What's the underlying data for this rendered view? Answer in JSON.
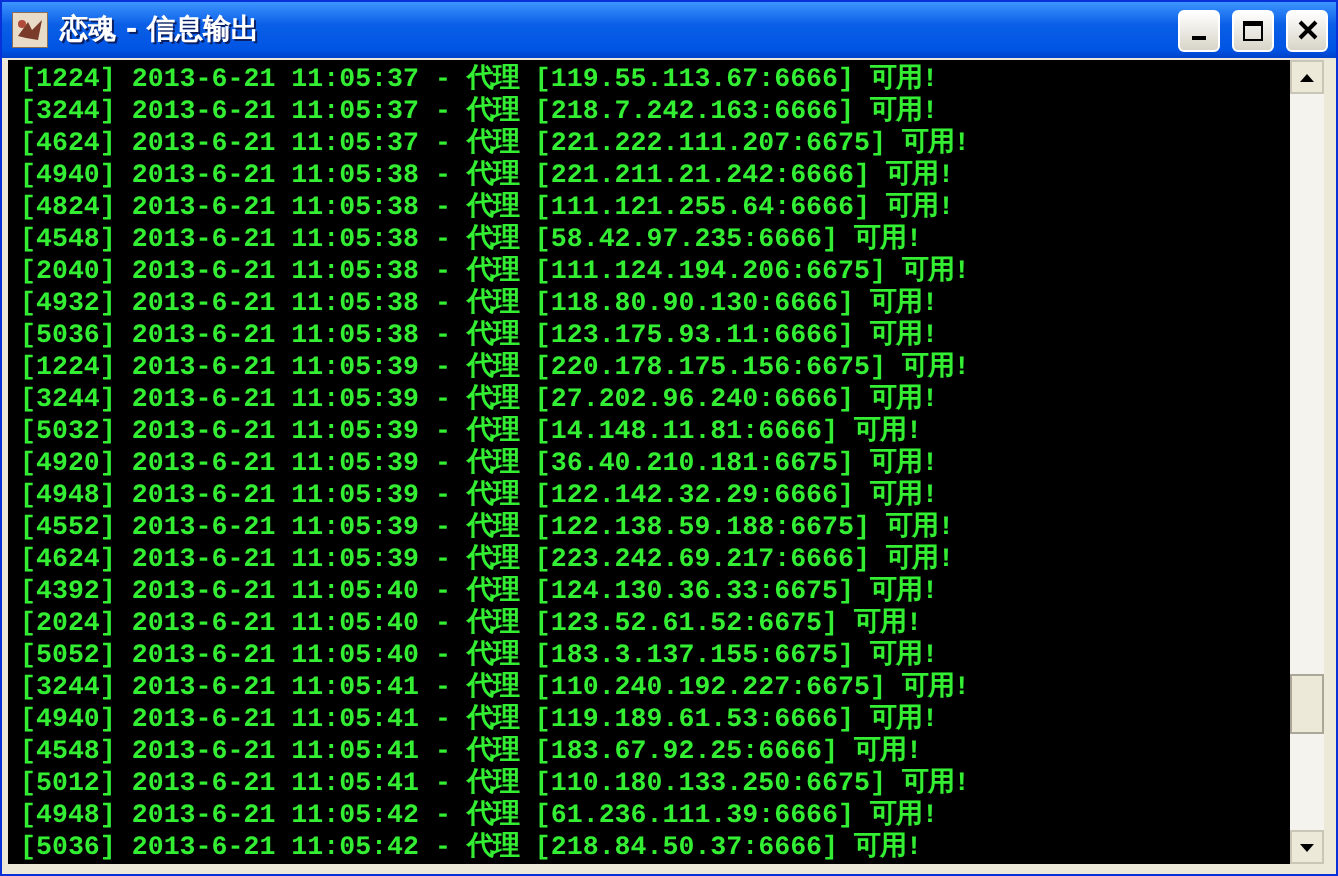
{
  "window": {
    "title": "恋魂 - 信息输出"
  },
  "lines": [
    "[1224] 2013-6-21 11:05:37 - 代理 [119.55.113.67:6666] 可用!",
    "[3244] 2013-6-21 11:05:37 - 代理 [218.7.242.163:6666] 可用!",
    "[4624] 2013-6-21 11:05:37 - 代理 [221.222.111.207:6675] 可用!",
    "[4940] 2013-6-21 11:05:38 - 代理 [221.211.21.242:6666] 可用!",
    "[4824] 2013-6-21 11:05:38 - 代理 [111.121.255.64:6666] 可用!",
    "[4548] 2013-6-21 11:05:38 - 代理 [58.42.97.235:6666] 可用!",
    "[2040] 2013-6-21 11:05:38 - 代理 [111.124.194.206:6675] 可用!",
    "[4932] 2013-6-21 11:05:38 - 代理 [118.80.90.130:6666] 可用!",
    "[5036] 2013-6-21 11:05:38 - 代理 [123.175.93.11:6666] 可用!",
    "[1224] 2013-6-21 11:05:39 - 代理 [220.178.175.156:6675] 可用!",
    "[3244] 2013-6-21 11:05:39 - 代理 [27.202.96.240:6666] 可用!",
    "[5032] 2013-6-21 11:05:39 - 代理 [14.148.11.81:6666] 可用!",
    "[4920] 2013-6-21 11:05:39 - 代理 [36.40.210.181:6675] 可用!",
    "[4948] 2013-6-21 11:05:39 - 代理 [122.142.32.29:6666] 可用!",
    "[4552] 2013-6-21 11:05:39 - 代理 [122.138.59.188:6675] 可用!",
    "[4624] 2013-6-21 11:05:39 - 代理 [223.242.69.217:6666] 可用!",
    "[4392] 2013-6-21 11:05:40 - 代理 [124.130.36.33:6675] 可用!",
    "[2024] 2013-6-21 11:05:40 - 代理 [123.52.61.52:6675] 可用!",
    "[5052] 2013-6-21 11:05:40 - 代理 [183.3.137.155:6675] 可用!",
    "[3244] 2013-6-21 11:05:41 - 代理 [110.240.192.227:6675] 可用!",
    "[4940] 2013-6-21 11:05:41 - 代理 [119.189.61.53:6666] 可用!",
    "[4548] 2013-6-21 11:05:41 - 代理 [183.67.92.25:6666] 可用!",
    "[5012] 2013-6-21 11:05:41 - 代理 [110.180.133.250:6675] 可用!",
    "[4948] 2013-6-21 11:05:42 - 代理 [61.236.111.39:6666] 可用!",
    "[5036] 2013-6-21 11:05:42 - 代理 [218.84.50.37:6666] 可用!"
  ]
}
